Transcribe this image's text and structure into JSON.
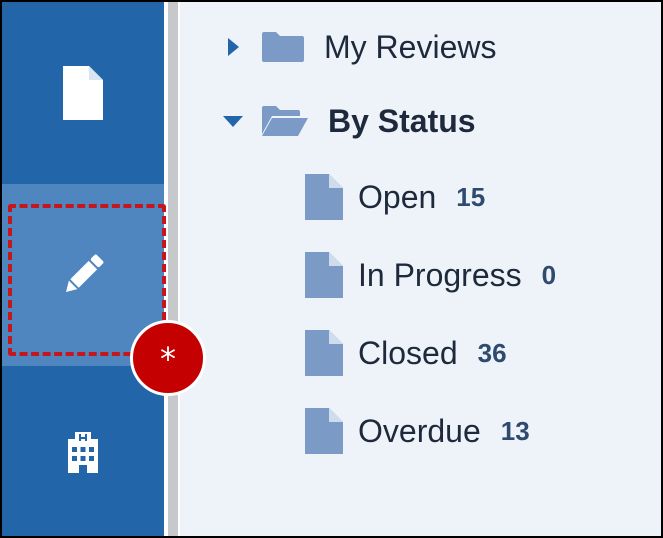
{
  "colors": {
    "sidebar": "#2265a8",
    "sidebar_active": "#4f86c0",
    "panel": "#eef3f9",
    "highlight": "#c4161c",
    "badge": "#c40000",
    "icon": "#7b9bc6"
  },
  "sidebar": {
    "items": [
      {
        "icon": "document-icon",
        "active": false
      },
      {
        "icon": "pencil-icon",
        "active": true
      },
      {
        "icon": "hospital-building-icon",
        "active": false
      }
    ]
  },
  "callout": {
    "badge_text": "*"
  },
  "tree": {
    "groups": [
      {
        "label": "My Reviews",
        "expanded": false,
        "icon": "folder-icon"
      },
      {
        "label": "By Status",
        "expanded": true,
        "icon": "folder-open-icon"
      }
    ],
    "status_items": [
      {
        "label": "Open",
        "count": "15"
      },
      {
        "label": "In Progress",
        "count": "0"
      },
      {
        "label": "Closed",
        "count": "36"
      },
      {
        "label": "Overdue",
        "count": "13"
      }
    ]
  }
}
